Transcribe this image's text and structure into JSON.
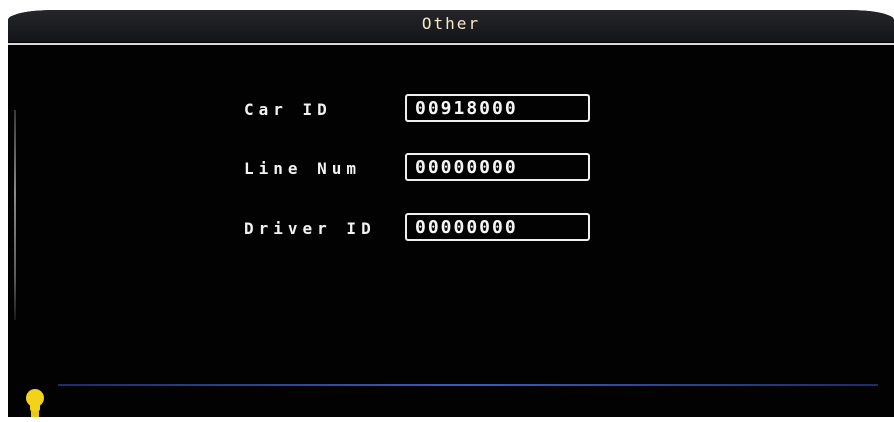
{
  "window": {
    "title": "Other"
  },
  "fields": [
    {
      "label": "Car ID",
      "value": "00918000"
    },
    {
      "label": "Line Num",
      "value": "00000000"
    },
    {
      "label": "Driver ID",
      "value": "00000000"
    }
  ],
  "icons": {
    "status": "lightbulb-icon"
  },
  "colors": {
    "background": "#020203",
    "title_text": "#f4e8c6",
    "field_border": "#efefef",
    "bottom_rule": "#3c5bbf",
    "bulb": "#f2d21a"
  }
}
